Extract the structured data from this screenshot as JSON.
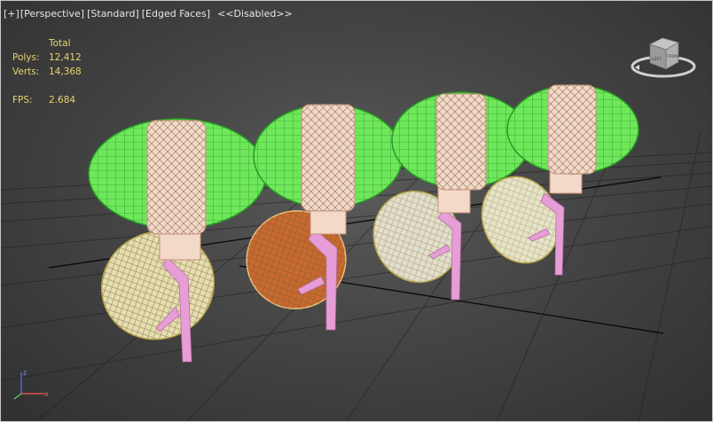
{
  "viewport": {
    "labels": {
      "menu": "[+]",
      "view": "[Perspective]",
      "shading_mode": "[Standard]",
      "edged_faces": "[Edged Faces]",
      "disabled": "<<Disabled>>"
    },
    "stats": {
      "header": "Total",
      "polys_label": "Polys:",
      "polys_value": "12,412",
      "verts_label": "Verts:",
      "verts_value": "14,368",
      "fps_label": "FPS:",
      "fps_value": "2.684"
    },
    "viewcube": {
      "left_face": "LEFT",
      "front_face": "FRONT"
    },
    "axis_tripod": {
      "x": "x",
      "z": "z"
    }
  },
  "colors": {
    "shade_wire": "#6ee85a",
    "inner_tube": "#f3d9c8",
    "stem": "#e79ed6",
    "disc_light": "#e5dfb0",
    "disc_orange": "#c8692d",
    "grid": "#1e1e1e",
    "stats_text": "#e8d36b"
  }
}
